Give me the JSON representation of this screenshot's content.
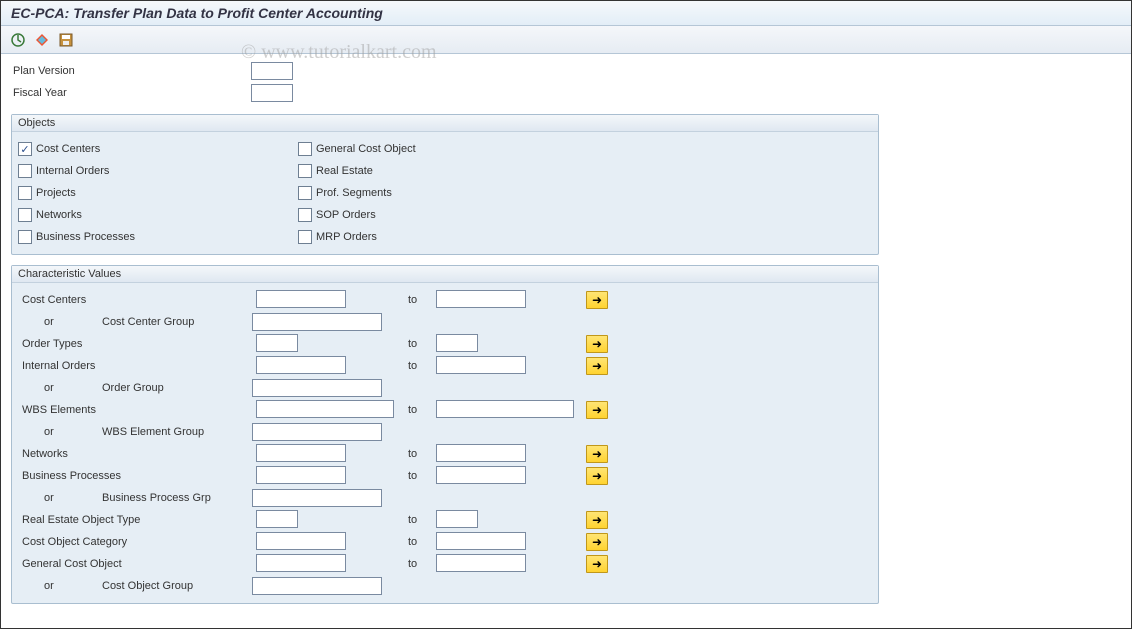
{
  "title": "EC-PCA: Transfer Plan Data to Profit Center Accounting",
  "watermark": "© www.tutorialkart.com",
  "toolbar": {
    "execute": "⏱",
    "variant": "◈",
    "save": "▂"
  },
  "header_fields": [
    {
      "label": "Plan Version",
      "value": ""
    },
    {
      "label": "Fiscal Year",
      "value": ""
    }
  ],
  "objects": {
    "title": "Objects",
    "left": [
      {
        "label": "Cost Centers",
        "checked": true
      },
      {
        "label": "Internal Orders",
        "checked": false
      },
      {
        "label": "Projects",
        "checked": false
      },
      {
        "label": "Networks",
        "checked": false
      },
      {
        "label": "Business Processes",
        "checked": false
      }
    ],
    "right": [
      {
        "label": "General Cost Object",
        "checked": false
      },
      {
        "label": "Real Estate",
        "checked": false
      },
      {
        "label": "Prof. Segments",
        "checked": false
      },
      {
        "label": "SOP Orders",
        "checked": false
      },
      {
        "label": "MRP Orders",
        "checked": false
      }
    ]
  },
  "cv": {
    "title": "Characteristic Values",
    "to_label": "to",
    "or_label": "or",
    "rows": [
      {
        "type": "range",
        "label": "Cost Centers",
        "width": "med",
        "to": true
      },
      {
        "type": "or",
        "label": "Cost Center Group"
      },
      {
        "type": "range",
        "label": "Order Types",
        "width": "short",
        "to": true
      },
      {
        "type": "range",
        "label": "Internal Orders",
        "width": "med",
        "to": true
      },
      {
        "type": "or",
        "label": "Order Group"
      },
      {
        "type": "range",
        "label": "WBS Elements",
        "width": "xwide",
        "to": true
      },
      {
        "type": "or",
        "label": "WBS Element Group"
      },
      {
        "type": "range",
        "label": "Networks",
        "width": "med",
        "to": true
      },
      {
        "type": "range",
        "label": "Business Processes",
        "width": "med",
        "to": true
      },
      {
        "type": "or",
        "label": "Business Process Grp"
      },
      {
        "type": "range",
        "label": "Real Estate Object Type",
        "width": "short",
        "to": true
      },
      {
        "type": "range",
        "label": "Cost Object Category",
        "width": "med",
        "to": true
      },
      {
        "type": "range",
        "label": "General Cost Object",
        "width": "med",
        "to": true
      },
      {
        "type": "or",
        "label": "Cost Object Group"
      }
    ]
  }
}
